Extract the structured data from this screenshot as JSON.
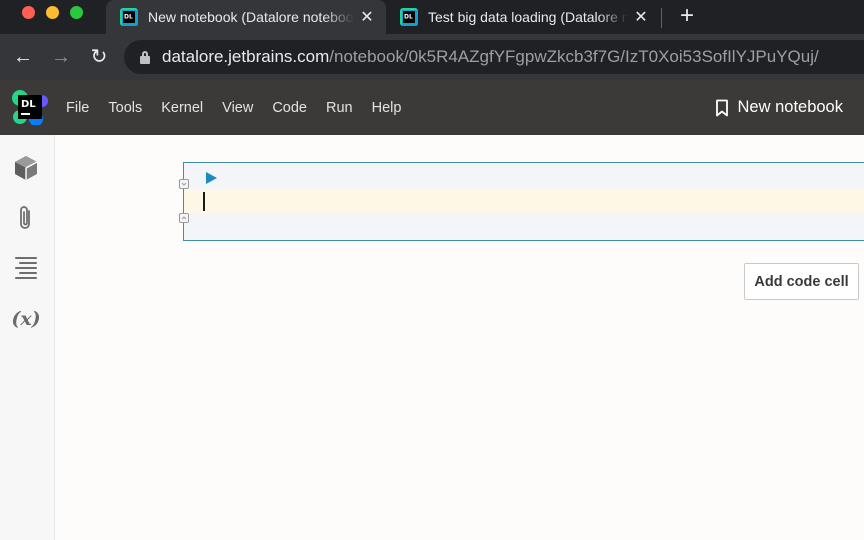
{
  "browser": {
    "tabs": [
      {
        "title": "New notebook (Datalore notebook)",
        "active": true,
        "close_label": "✕",
        "favicon": "datalore-favicon-icon"
      },
      {
        "title": "Test big data loading (Datalore notebook)",
        "active": false,
        "close_label": "✕",
        "favicon": "datalore-favicon-icon"
      }
    ],
    "new_tab_label": "+",
    "nav": {
      "back": "←",
      "forward": "→",
      "reload": "↻"
    },
    "url_host": "datalore.jetbrains.com",
    "url_path": "/notebook/0k5R4AZgfYFgpwZkcb3f7G/IzT0Xoi53SofIlYJPuYQuj/"
  },
  "app": {
    "logo_text": "DL",
    "menu": [
      "File",
      "Tools",
      "Kernel",
      "View",
      "Code",
      "Run",
      "Help"
    ],
    "notebook_title": "New notebook",
    "sidebar_icons": [
      "cube-icon",
      "paperclip-icon",
      "outline-list-icon",
      "variables-icon"
    ],
    "variables_label": "(x)"
  },
  "notebook": {
    "cells": [
      {
        "type": "code",
        "source": ""
      }
    ],
    "add_cell_label": "Add code cell"
  },
  "colors": {
    "tab_strip": "#202124",
    "toolbar": "#35363a",
    "app_bar": "#3c3a38",
    "cell_border": "#3e8fa6",
    "run_button": "#1b8ac0",
    "active_line": "#fdf7e5"
  }
}
